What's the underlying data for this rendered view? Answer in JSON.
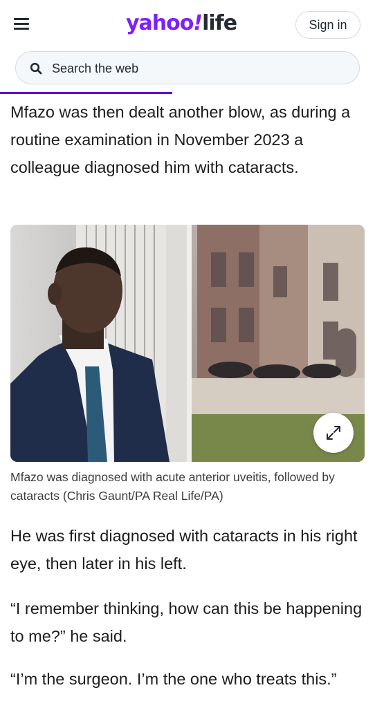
{
  "header": {
    "logo_primary": "yahoo",
    "logo_mark": "!",
    "logo_secondary": "life",
    "sign_in_label": "Sign in",
    "menu_icon": "hamburger-menu-icon",
    "brand_color": "#7e1fff"
  },
  "search": {
    "placeholder": "Search the web",
    "icon": "search-icon"
  },
  "article": {
    "reading_progress": 0.46,
    "paragraphs": [
      "Mfazo was then dealt another blow, as during a routine examination in November 2023 a colleague diagnosed him with cataracts.",
      "He was first diagnosed with cataracts in his right eye, then later in his left.",
      "“I remember thinking, how can this be happening to me?” he said.",
      "“I’m the surgeon. I’m the one who treats this.”"
    ],
    "image": {
      "caption": "Mfazo was diagnosed with acute anterior uveitis, followed by cataracts (Chris Gaunt/PA Real Life/PA)",
      "expand_icon": "expand-icon"
    }
  }
}
